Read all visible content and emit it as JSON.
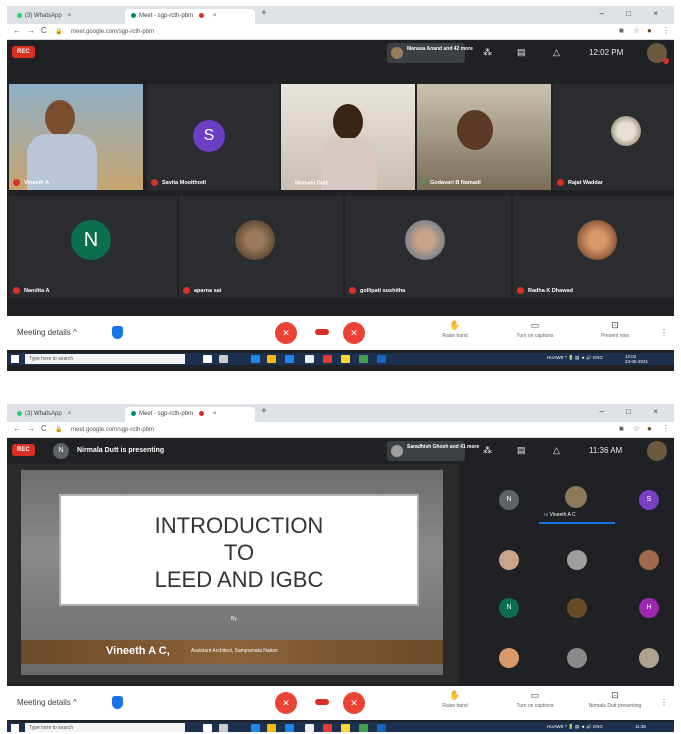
{
  "browser": {
    "tabs": [
      {
        "label": "(3) WhatsApp",
        "close": "×"
      },
      {
        "label": "Meet - sgp-rcth-pbm",
        "close": "×"
      }
    ],
    "new_tab": "+",
    "window_controls": "– □ ×",
    "url_shot1": "meet.google.com/sgp-rcth-pbm",
    "url_shot2": "meet.google.com/sgp-rcth-pbm"
  },
  "shot1": {
    "rec_label": "REC",
    "joined_text": "Manasa Anand and 42 more",
    "clock": "12:02 PM",
    "badge_count": "0",
    "participants": [
      {
        "name": "Vineeth A",
        "initial": ""
      },
      {
        "name": "Savita Moolthodi",
        "initial": "S"
      },
      {
        "name": "Nirmala Dutt",
        "initial": ""
      },
      {
        "name": "Godavari B Namadi",
        "initial": ""
      },
      {
        "name": "Rajat Waddar",
        "initial": ""
      },
      {
        "name": "Nandita A",
        "initial": "N"
      },
      {
        "name": "aparna sai",
        "initial": ""
      },
      {
        "name": "gollipati sushitha",
        "initial": ""
      },
      {
        "name": "Radha K Dhawad",
        "initial": ""
      }
    ]
  },
  "shot2": {
    "rec_label": "REC",
    "presenter_initial": "N",
    "presenting_text": "Nirmala Dutt is presenting",
    "joined_text": "Saradhish Ghosh and 41 more",
    "clock": "11:36 AM",
    "slide": {
      "line1": "INTRODUCTION",
      "line2": "TO",
      "line3": "LEED AND IGBC",
      "by": "By",
      "author": "Vineeth A C,",
      "author_title": "Assistant Architect, Sampurnata Nation"
    },
    "side_participants": {
      "speaking_name": "Vineeth A C",
      "initials": [
        "N",
        "S",
        "N",
        "H"
      ]
    },
    "present_now_label": "Nirmala Dutt presenting"
  },
  "bottombar": {
    "meeting_details": "Meeting details",
    "chevron": "^",
    "raise_hand": "Raise hand",
    "captions": "Turn on captions",
    "present_now": "Present now",
    "more": "⋮"
  },
  "taskbar": {
    "search_placeholder": "Type here to search",
    "tray_text": "HUAWE ^ 🔋 ▤ ◄ 🔊 ENG",
    "time": "12:02",
    "date": "23-05-2021",
    "time2": "11:36"
  },
  "colors": {
    "meet_dark": "#202124",
    "tile_gray": "#3c4043",
    "red": "#ea4335",
    "blue": "#1a73e8",
    "purple": "#7b3fc4",
    "teal_n": "#0b6e4f"
  }
}
